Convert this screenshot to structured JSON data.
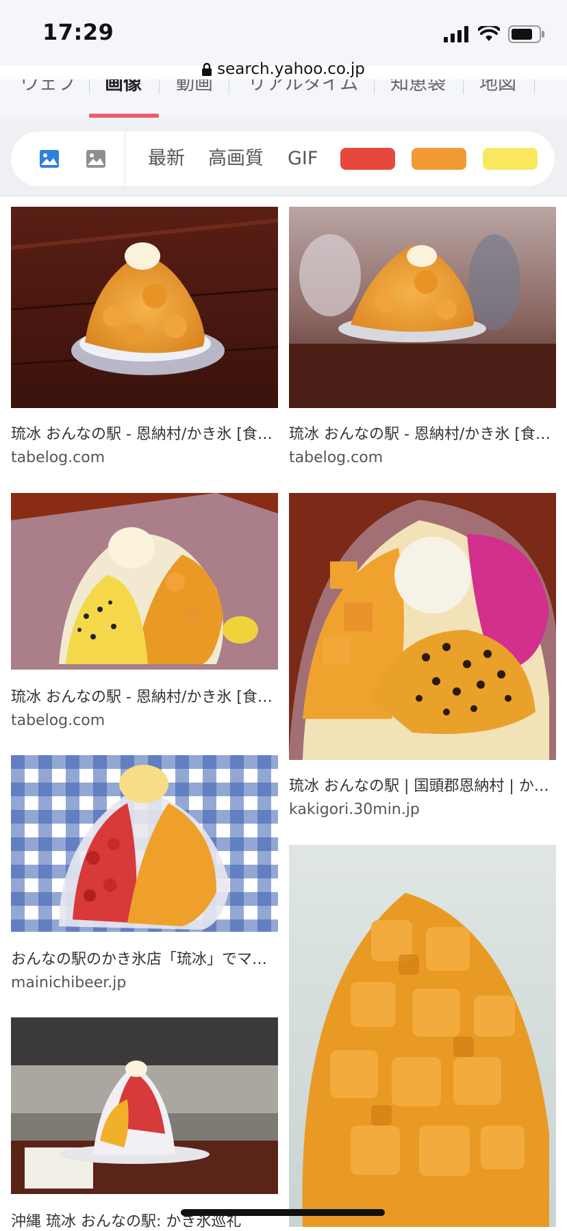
{
  "status_bar": {
    "time": "17:29"
  },
  "address_bar": {
    "url": "search.yahoo.co.jp"
  },
  "search_tabs": [
    {
      "label": "ウェブ"
    },
    {
      "label": "画像",
      "active": true
    },
    {
      "label": "動画"
    },
    {
      "label": "リアルタイム"
    },
    {
      "label": "知恵袋"
    },
    {
      "label": "地図"
    }
  ],
  "filters": {
    "icons": [
      "image-type-photo-icon",
      "image-type-illustration-icon"
    ],
    "options": [
      "最新",
      "高画質",
      "GIF"
    ],
    "color_chips": [
      {
        "name": "red",
        "color": "#e8473e"
      },
      {
        "name": "orange",
        "color": "#f29a35"
      },
      {
        "name": "yellow",
        "color": "#f9e85e"
      }
    ]
  },
  "results": [
    {
      "title": "琉冰 おんなの駅 - 恩納村/かき氷 [食べログ]",
      "domain": "tabelog.com"
    },
    {
      "title": "琉冰 おんなの駅 - 恩納村/かき氷 [食べログ]",
      "domain": "tabelog.com"
    },
    {
      "title": "琉冰 おんなの駅 - 恩納村/かき氷 [食べログ]",
      "domain": "tabelog.com"
    },
    {
      "title": "琉冰 おんなの駅 | 国頭郡恩納村 | かき氷",
      "domain": "kakigori.30min.jp"
    },
    {
      "title": "おんなの駅のかき氷店「琉冰」でマンゴーかき氷",
      "domain": "mainichibeer.jp"
    },
    {
      "title": "",
      "domain": ""
    },
    {
      "title": "沖縄 琉冰 おんなの駅: かき氷巡礼",
      "domain": ""
    }
  ]
}
